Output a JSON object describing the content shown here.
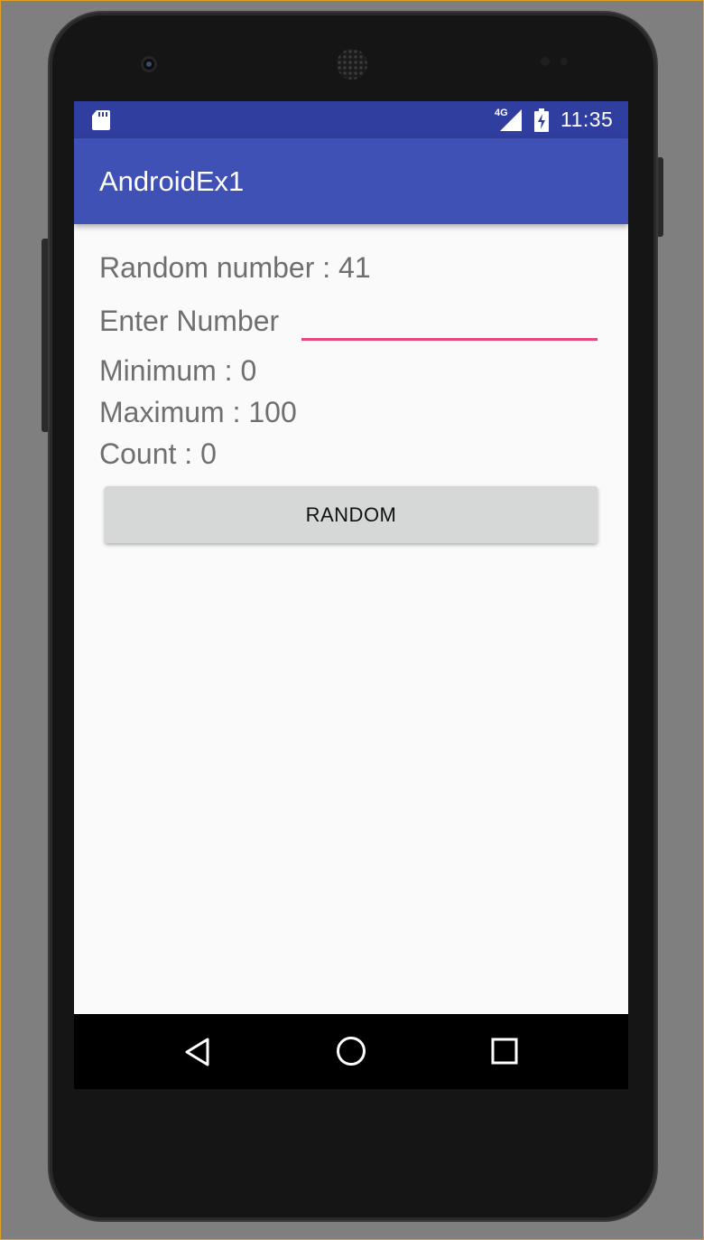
{
  "status_bar": {
    "network_label": "4G",
    "time": "11:35",
    "icons": [
      "sd-card-icon",
      "signal-icon",
      "battery-charging-icon"
    ]
  },
  "app_bar": {
    "title": "AndroidEx1",
    "color": "#3f51b5",
    "status_color": "#303f9f"
  },
  "main": {
    "random_number_text": "Random number : 41",
    "enter_label": "Enter Number",
    "input_value": "",
    "accent_color": "#e8467f",
    "minimum_text": "Minimum : 0",
    "maximum_text": "Maximum : 100",
    "count_text": "Count : 0",
    "random_button_label": "RANDOM"
  },
  "nav_bar": {
    "icons": [
      "back-icon",
      "home-icon",
      "recents-icon"
    ]
  }
}
